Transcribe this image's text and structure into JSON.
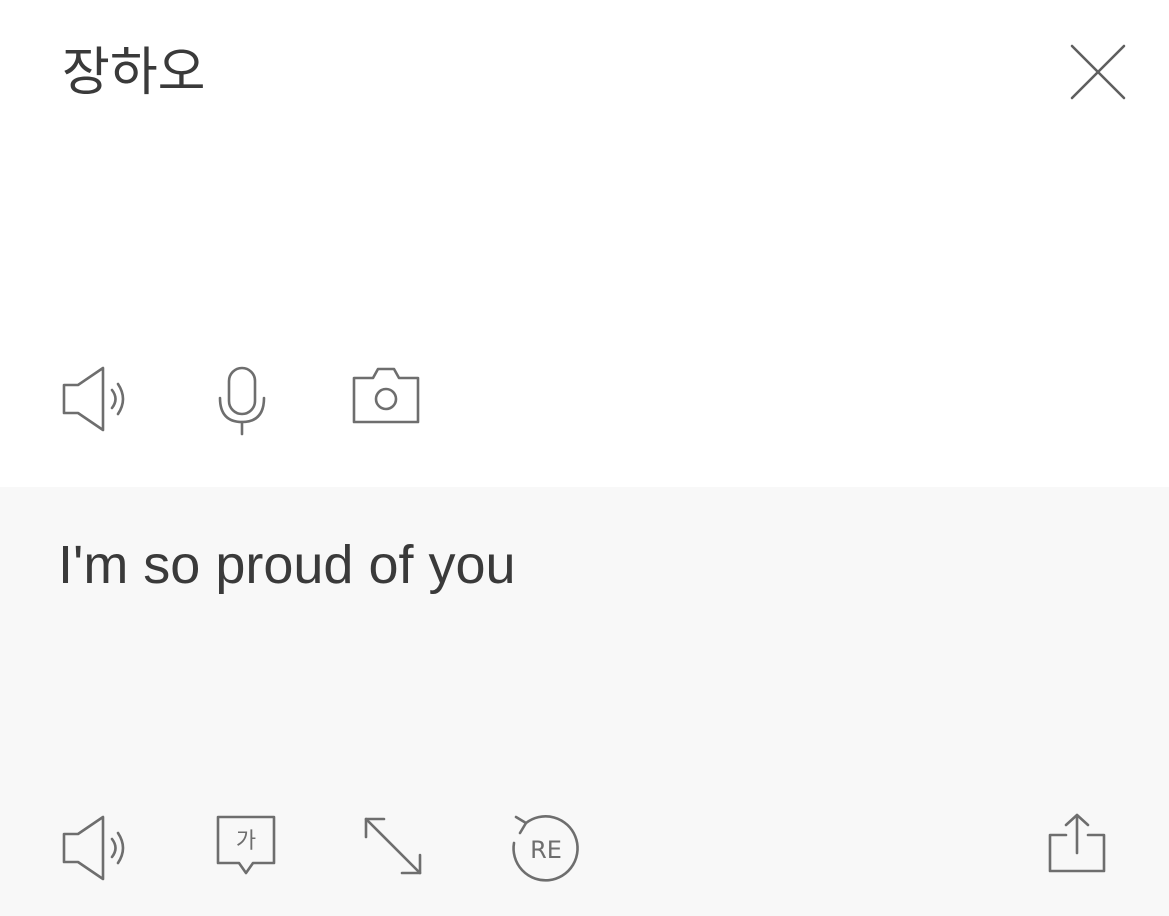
{
  "source": {
    "text": "장하오",
    "close_icon": "close-icon",
    "toolbar": [
      {
        "icon": "speaker-icon",
        "label": "listen"
      },
      {
        "icon": "microphone-icon",
        "label": "voice input"
      },
      {
        "icon": "camera-icon",
        "label": "camera input"
      }
    ]
  },
  "target": {
    "text": "I'm so proud of you",
    "toolbar": [
      {
        "icon": "speaker-icon"
      },
      {
        "icon": "korean-pronunciation-icon",
        "glyph": "가"
      },
      {
        "icon": "expand-icon"
      },
      {
        "icon": "retranslate-icon",
        "glyph": "RE"
      },
      {
        "icon": "share-icon"
      }
    ]
  },
  "colors": {
    "source_background": "#ffffff",
    "target_background": "#f8f8f8",
    "text": "#3a3a3a",
    "icon": "#6e6e6e"
  }
}
